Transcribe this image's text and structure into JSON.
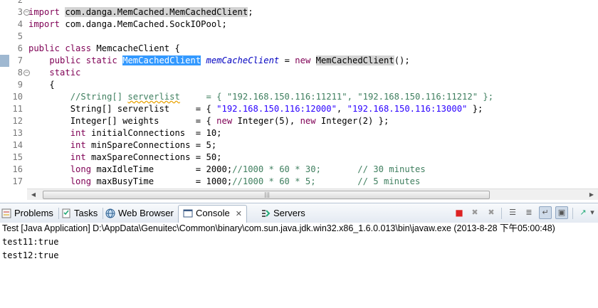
{
  "editor": {
    "lines": [
      {
        "num": "2",
        "marked": false,
        "fold": "",
        "indent": "",
        "segments": []
      },
      {
        "num": "3",
        "marked": false,
        "fold": "⊖",
        "indent": "",
        "segments": [
          {
            "t": "import",
            "c": "kw"
          },
          {
            "t": " "
          },
          {
            "t": "com.danga.MemCached.MemCachedClient",
            "c": "gray"
          },
          {
            "t": ";"
          }
        ]
      },
      {
        "num": "4",
        "marked": false,
        "fold": "",
        "indent": "",
        "segments": [
          {
            "t": "import",
            "c": "kw"
          },
          {
            "t": " com.danga.MemCached.SockIOPool;"
          }
        ]
      },
      {
        "num": "5",
        "marked": false,
        "fold": "",
        "indent": "",
        "segments": []
      },
      {
        "num": "6",
        "marked": false,
        "fold": "",
        "indent": "",
        "segments": [
          {
            "t": "public",
            "c": "kw"
          },
          {
            "t": " "
          },
          {
            "t": "class",
            "c": "kw"
          },
          {
            "t": " MemcacheClient {"
          }
        ]
      },
      {
        "num": "7",
        "marked": true,
        "fold": "",
        "indent": "    ",
        "segments": [
          {
            "t": "public",
            "c": "kw"
          },
          {
            "t": " "
          },
          {
            "t": "static",
            "c": "kw"
          },
          {
            "t": " "
          },
          {
            "t": "MemCachedClient",
            "c": "sel"
          },
          {
            "t": " "
          },
          {
            "t": "memCacheClient",
            "c": "fld"
          },
          {
            "t": " = "
          },
          {
            "t": "new",
            "c": "kw"
          },
          {
            "t": " "
          },
          {
            "t": "MemCachedClient",
            "c": "gray"
          },
          {
            "t": "();"
          }
        ]
      },
      {
        "num": "8",
        "marked": false,
        "fold": "⊖",
        "indent": "    ",
        "segments": [
          {
            "t": "static",
            "c": "kw"
          }
        ]
      },
      {
        "num": "9",
        "marked": false,
        "fold": "",
        "indent": "    ",
        "segments": [
          {
            "t": "{"
          }
        ]
      },
      {
        "num": "10",
        "marked": false,
        "fold": "",
        "indent": "        ",
        "segments": [
          {
            "t": "//String[] ",
            "c": "cmt"
          },
          {
            "t": "serverlist",
            "c": "cmt squig"
          },
          {
            "t": "     = { \"192.168.150.116:11211\", \"192.168.150.116:11212\" };",
            "c": "cmt"
          }
        ]
      },
      {
        "num": "11",
        "marked": false,
        "fold": "",
        "indent": "        ",
        "segments": [
          {
            "t": "String[] serverlist     = { "
          },
          {
            "t": "\"192.168.150.116:12000\"",
            "c": "str"
          },
          {
            "t": ", "
          },
          {
            "t": "\"192.168.150.116:13000\"",
            "c": "str"
          },
          {
            "t": " };"
          }
        ]
      },
      {
        "num": "12",
        "marked": false,
        "fold": "",
        "indent": "        ",
        "segments": [
          {
            "t": "Integer[] weights       = { "
          },
          {
            "t": "new",
            "c": "kw"
          },
          {
            "t": " Integer(5), "
          },
          {
            "t": "new",
            "c": "kw"
          },
          {
            "t": " Integer(2) };"
          }
        ]
      },
      {
        "num": "13",
        "marked": false,
        "fold": "",
        "indent": "        ",
        "segments": [
          {
            "t": "int",
            "c": "kw"
          },
          {
            "t": " initialConnections  = 10;"
          }
        ]
      },
      {
        "num": "14",
        "marked": false,
        "fold": "",
        "indent": "        ",
        "segments": [
          {
            "t": "int",
            "c": "kw"
          },
          {
            "t": " minSpareConnections = 5;"
          }
        ]
      },
      {
        "num": "15",
        "marked": false,
        "fold": "",
        "indent": "        ",
        "segments": [
          {
            "t": "int",
            "c": "kw"
          },
          {
            "t": " maxSpareConnections = 50;"
          }
        ]
      },
      {
        "num": "16",
        "marked": false,
        "fold": "",
        "indent": "        ",
        "segments": [
          {
            "t": "long",
            "c": "kw"
          },
          {
            "t": " maxIdleTime        = 2000;"
          },
          {
            "t": "//1000 * 60 * 30;       // 30 minutes",
            "c": "cmt"
          }
        ]
      },
      {
        "num": "17",
        "marked": false,
        "fold": "",
        "indent": "        ",
        "segments": [
          {
            "t": "long",
            "c": "kw"
          },
          {
            "t": " maxBusyTime        = 1000;"
          },
          {
            "t": "//1000 * 60 * 5;        // 5 minutes",
            "c": "cmt"
          }
        ]
      }
    ],
    "scroll_grip": "|||",
    "scroll_left_arrow": "◀",
    "scroll_right_arrow": "▶"
  },
  "views": {
    "tabs": [
      {
        "label": "Problems",
        "icon": "problems-icon",
        "active": false
      },
      {
        "label": "Tasks",
        "icon": "tasks-icon",
        "active": false
      },
      {
        "label": "Web Browser",
        "icon": "web-browser-icon",
        "active": false
      },
      {
        "label": "Console",
        "icon": "console-icon",
        "active": true,
        "close": "✕"
      },
      {
        "label": "Servers",
        "icon": "servers-icon",
        "active": false
      }
    ],
    "toolbar": [
      {
        "name": "terminate-icon",
        "glyph": "■"
      },
      {
        "name": "remove-launch-icon",
        "glyph": "✖"
      },
      {
        "name": "remove-all-terminated-icon",
        "glyph": "✖"
      },
      {
        "name": "clear-console-icon",
        "glyph": "☰"
      },
      {
        "name": "scroll-lock-icon",
        "glyph": "≣"
      },
      {
        "name": "word-wrap-icon",
        "glyph": "↵"
      },
      {
        "name": "pin-console-icon",
        "glyph": "▣"
      },
      {
        "name": "display-selected-console-icon",
        "glyph": "▤"
      },
      {
        "name": "open-console-icon",
        "glyph": "↗"
      },
      {
        "name": "view-menu-icon",
        "glyph": "▾"
      }
    ]
  },
  "console": {
    "title": "Test [Java Application] D:\\AppData\\Genuitec\\Common\\binary\\com.sun.java.jdk.win32.x86_1.6.0.013\\bin\\javaw.exe (2013-8-28 下午05:00:48)",
    "output": [
      "test11:true",
      "test12:true"
    ]
  }
}
